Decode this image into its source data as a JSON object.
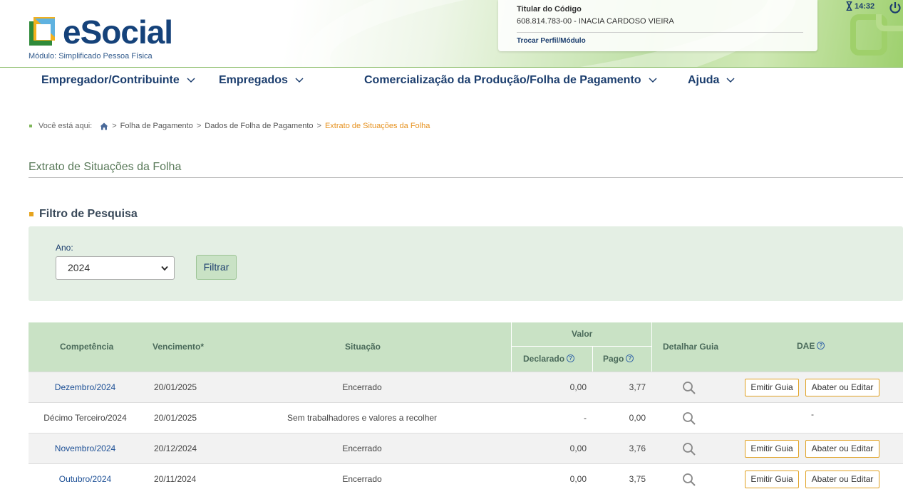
{
  "header": {
    "brand": "eSocial",
    "module": "Módulo: Simplificado Pessoa Física",
    "user_label": "Titular do Código",
    "user_value": "608.814.783-00 - INACIA CARDOSO VIEIRA",
    "switch_profile": "Trocar Perfil/Módulo",
    "timer": "14:32"
  },
  "nav": {
    "items": [
      {
        "label": "Empregador/Contribuinte"
      },
      {
        "label": "Empregados"
      },
      {
        "label": "Comercialização da Produção/Folha de Pagamento"
      },
      {
        "label": "Ajuda"
      }
    ]
  },
  "breadcrumb": {
    "prefix": "Você está aqui:",
    "sep": ">",
    "items": [
      "Folha de Pagamento",
      "Dados de Folha de Pagamento"
    ],
    "current": "Extrato de Situações da Folha"
  },
  "page": {
    "title": "Extrato de Situações da Folha",
    "filter_title": "Filtro de Pesquisa",
    "year_label": "Ano:",
    "year_value": "2024",
    "filter_button": "Filtrar"
  },
  "table": {
    "headers": {
      "competencia": "Competência",
      "vencimento": "Vencimento*",
      "situacao": "Situação",
      "valor": "Valor",
      "declarado": "Declarado",
      "pago": "Pago",
      "detalhar": "Detalhar Guia",
      "dae": "DAE",
      "help": "?"
    },
    "emitir": "Emitir Guia",
    "abater": "Abater ou Editar",
    "rows": [
      {
        "competencia": "Dezembro/2024",
        "vencimento": "20/01/2025",
        "situacao": "Encerrado",
        "declarado": "0,00",
        "pago": "3,77",
        "dae": ""
      },
      {
        "competencia": "Décimo Terceiro/2024",
        "vencimento": "20/01/2025",
        "situacao": "Sem trabalhadores e valores a recolher",
        "declarado": "-",
        "pago": "0,00",
        "dae": "-"
      },
      {
        "competencia": "Novembro/2024",
        "vencimento": "20/12/2024",
        "situacao": "Encerrado",
        "declarado": "0,00",
        "pago": "3,76",
        "dae": ""
      },
      {
        "competencia": "Outubro/2024",
        "vencimento": "20/11/2024",
        "situacao": "Encerrado",
        "declarado": "0,00",
        "pago": "3,75",
        "dae": ""
      }
    ]
  },
  "colors": {
    "primary": "#1c3e6e",
    "accent": "#e6911e",
    "table_header": "#c9e2c5"
  }
}
